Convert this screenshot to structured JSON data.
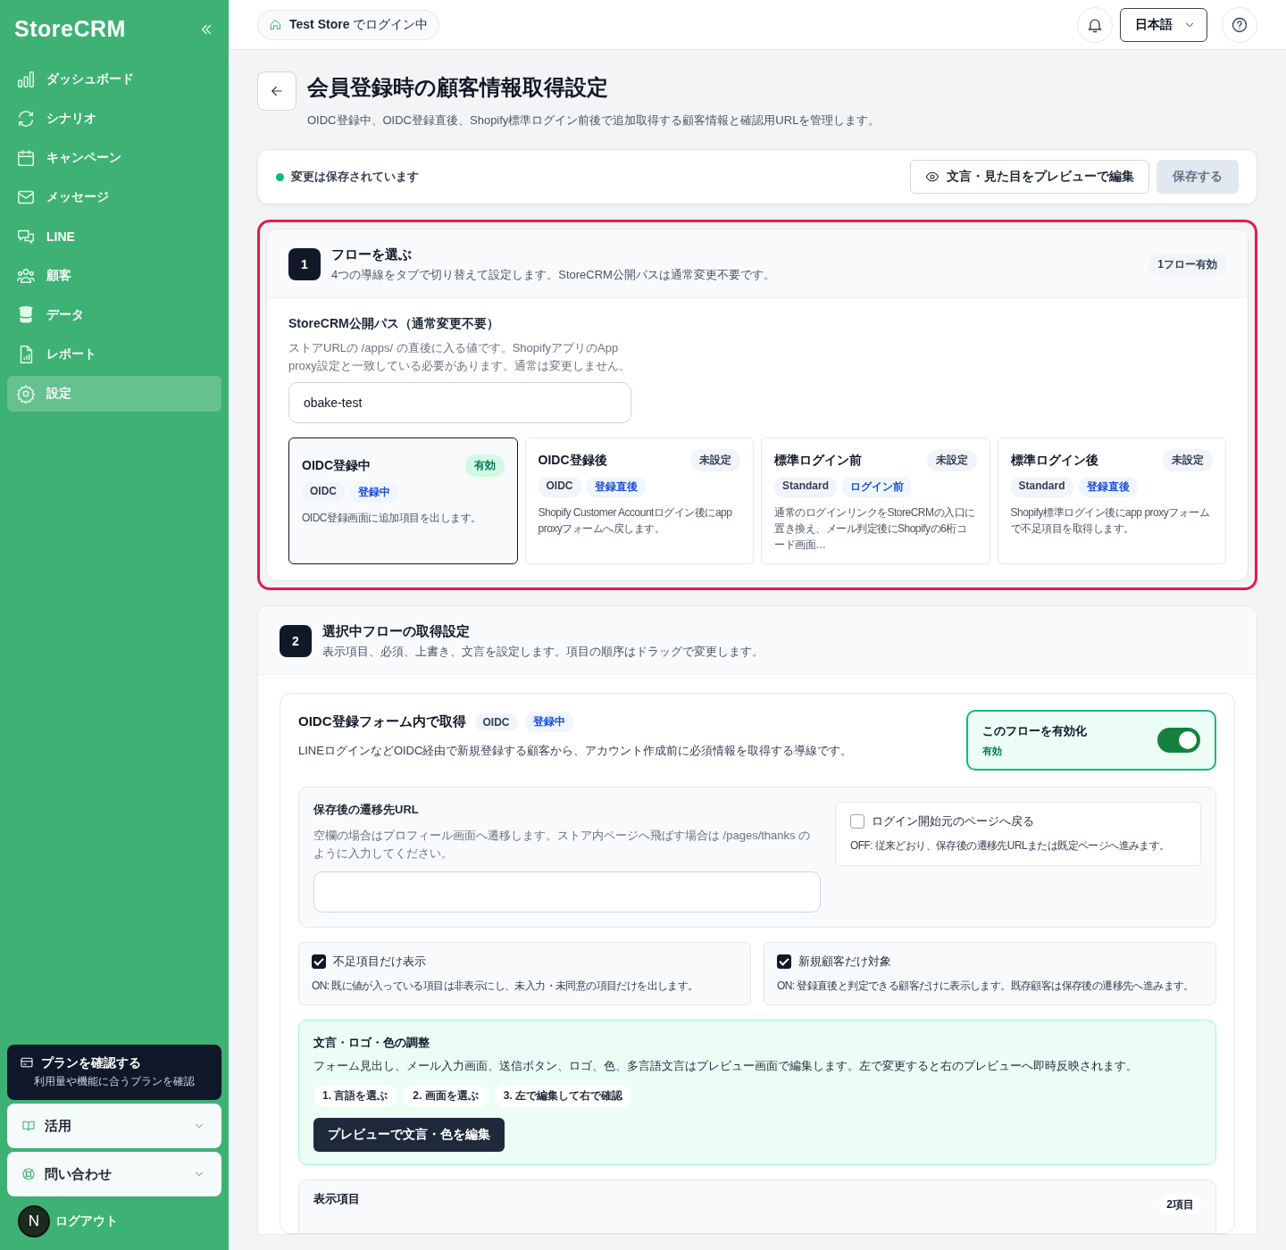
{
  "sidebar": {
    "logo": "StoreCRM",
    "items": [
      {
        "label": "ダッシュボード",
        "selected": false
      },
      {
        "label": "シナリオ",
        "selected": false
      },
      {
        "label": "キャンペーン",
        "selected": false
      },
      {
        "label": "メッセージ",
        "selected": false
      },
      {
        "label": "LINE",
        "selected": false
      },
      {
        "label": "顧客",
        "selected": false
      },
      {
        "label": "データ",
        "selected": false
      },
      {
        "label": "レポート",
        "selected": false
      },
      {
        "label": "設定",
        "selected": true
      }
    ],
    "plan": {
      "title": "プランを確認する",
      "subtitle": "利用量や機能に合うプランを確認"
    },
    "accordions": [
      {
        "label": "活用",
        "expanded": false
      },
      {
        "label": "問い合わせ",
        "expanded": false
      }
    ],
    "user": {
      "initial": "N",
      "logout": "ログアウト"
    }
  },
  "topbar": {
    "store": "**Test Store** でログイン中",
    "language": "日本語"
  },
  "header": {
    "title": "会員登録時の顧客情報取得設定",
    "subtitle": "OIDC登録中、OIDC登録直後、Shopify標準ログイン前後で追加取得する顧客情報と確認用URLを管理します。"
  },
  "save_bar": {
    "status": "変更は保存されています",
    "saved": true,
    "preview_button": "文言・見た目をプレビューで編集",
    "save_button": {
      "label": "保存する",
      "disabled": true
    }
  },
  "flow_select": {
    "number": "1",
    "title": "フローを選ぶ",
    "subtitle": "4つの導線をタブで切り替えて設定します。StoreCRM公開パスは通常変更不要です。",
    "badge": "1フロー有効",
    "highlighted": true,
    "path_field": {
      "label": "StoreCRM公開パス（通常変更不要）",
      "help": "ストアURLの /apps/ の直後に入る値です。ShopifyアプリのApp proxy設定と一致している必要があります。通常は変更しません。",
      "value": "obake-test"
    },
    "flows": [
      {
        "title": "OIDC登録中",
        "status": "有効",
        "enabled": true,
        "selected": true,
        "tags": [
          {
            "label": "OIDC",
            "kind": "type"
          },
          {
            "label": "登録中",
            "kind": "timing"
          }
        ],
        "description": "OIDC登録画面に追加項目を出します。"
      },
      {
        "title": "OIDC登録後",
        "status": "未設定",
        "enabled": false,
        "selected": false,
        "tags": [
          {
            "label": "OIDC",
            "kind": "type"
          },
          {
            "label": "登録直後",
            "kind": "timing"
          }
        ],
        "description": "Shopify Customer Accountログイン後にapp proxyフォームへ戻します。"
      },
      {
        "title": "標準ログイン前",
        "status": "未設定",
        "enabled": false,
        "selected": false,
        "tags": [
          {
            "label": "Standard",
            "kind": "type"
          },
          {
            "label": "ログイン前",
            "kind": "timing"
          }
        ],
        "description": "通常のログインリンクをStoreCRMの入口に置き換え、メール判定後にShopifyの6桁コード画面…"
      },
      {
        "title": "標準ログイン後",
        "status": "未設定",
        "enabled": false,
        "selected": false,
        "tags": [
          {
            "label": "Standard",
            "kind": "type"
          },
          {
            "label": "登録直後",
            "kind": "timing"
          }
        ],
        "description": "Shopify標準ログイン後にapp proxyフォームで不足項目を取得します。"
      }
    ]
  },
  "flow_settings": {
    "number": "2",
    "title": "選択中フローの取得設定",
    "subtitle": "表示項目、必須、上書き、文言を設定します。項目の順序はドラッグで変更します。",
    "panel": {
      "title": "OIDC登録フォーム内で取得",
      "tags": [
        {
          "label": "OIDC",
          "kind": "type"
        },
        {
          "label": "登録中",
          "kind": "timing"
        }
      ],
      "description": "LINEログインなどOIDC経由で新規登録する顧客から、アカウント作成前に必須情報を取得する導線です。",
      "toggle": {
        "label": "このフローを有効化",
        "state_label": "有効",
        "on": true
      }
    },
    "redirect": {
      "label": "保存後の遷移先URL",
      "help": "空欄の場合はプロフィール画面へ遷移します。ストア内ページへ飛ばす場合は /pages/thanks のように入力してください。"
    },
    "return_option": {
      "label": "ログイン開始元のページへ戻る",
      "checked": false,
      "note": "OFF: 従来どおり、保存後の遷移先URLまたは既定ページへ進みます。"
    },
    "options": [
      {
        "label": "不足項目だけ表示",
        "checked": true,
        "note": "ON: 既に値が入っている項目は非表示にし、未入力・未同意の項目だけを出します。"
      },
      {
        "label": "新規顧客だけ対象",
        "checked": true,
        "note": "ON: 登録直後と判定できる顧客だけに表示します。既存顧客は保存後の遷移先へ進みます。"
      }
    ],
    "appearance": {
      "title": "文言・ロゴ・色の調整",
      "description": "フォーム見出し、メール入力画面、送信ボタン、ロゴ、色、多言語文言はプレビュー画面で編集します。左で変更すると右のプレビューへ即時反映されます。",
      "steps": [
        "1. 言語を選ぶ",
        "2. 画面を選ぶ",
        "3. 左で編集して右で確認"
      ],
      "button": "プレビューで文言・色を編集"
    },
    "display_items": {
      "title": "表示項目",
      "count": "2項目"
    }
  }
}
